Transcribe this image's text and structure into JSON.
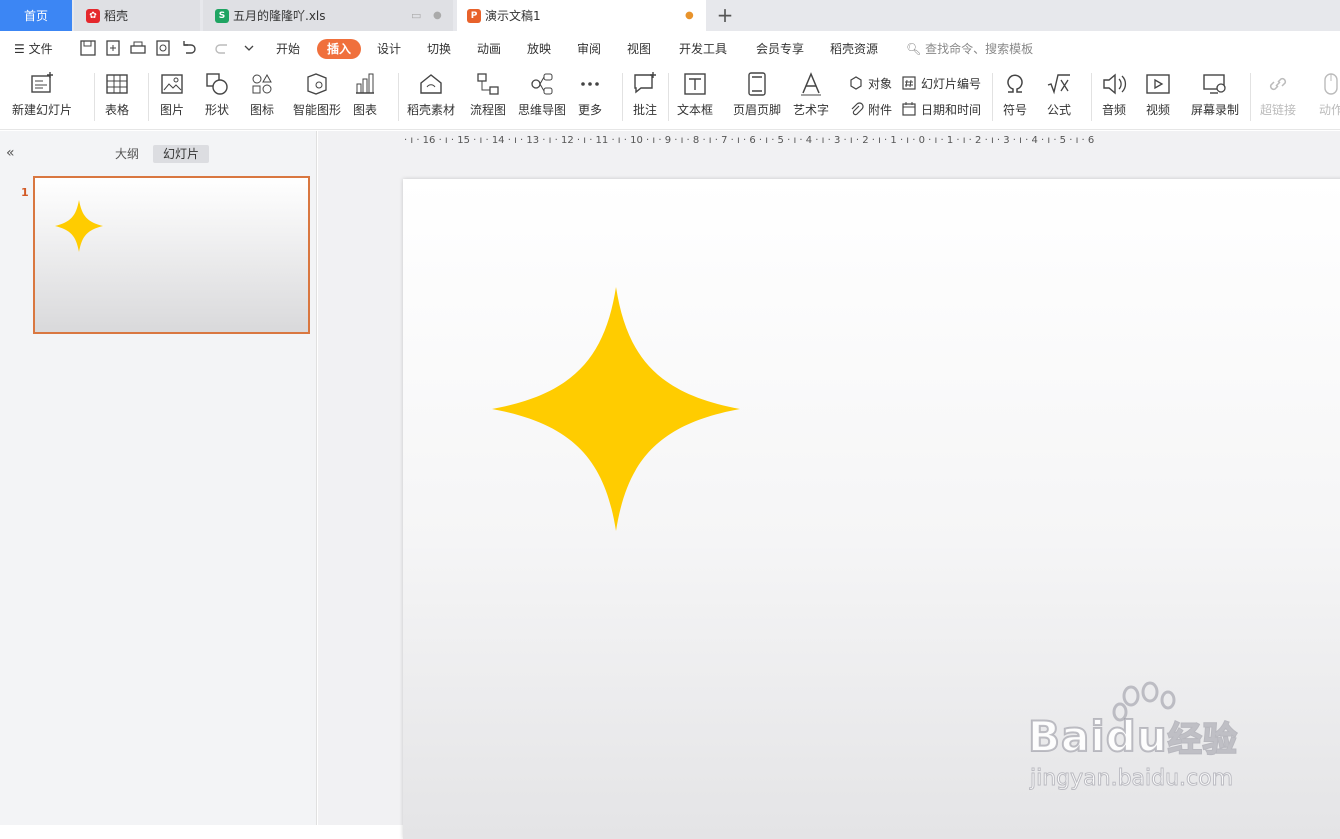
{
  "tabs": {
    "home": "首页",
    "daoke": "稻壳",
    "xls": "五月的隆隆吖.xls",
    "ppt": "演示文稿1",
    "add": "+"
  },
  "menu": {
    "file": "文件",
    "items": [
      "开始",
      "插入",
      "设计",
      "切换",
      "动画",
      "放映",
      "审阅",
      "视图",
      "开发工具",
      "会员专享",
      "稻壳资源"
    ],
    "active": "插入",
    "search_placeholder": "查找命令、搜索模板"
  },
  "toolbar": {
    "new_slide": "新建幻灯片",
    "table": "表格",
    "picture": "图片",
    "shape": "形状",
    "icon": "图标",
    "smart": "智能图形",
    "chart": "图表",
    "material": "稻壳素材",
    "flow": "流程图",
    "mind": "思维导图",
    "more": "更多",
    "comment": "批注",
    "textbox": "文本框",
    "header": "页眉页脚",
    "wordart": "艺术字",
    "object": "对象",
    "attach": "附件",
    "slide_number": "幻灯片编号",
    "datetime": "日期和时间",
    "symbol": "符号",
    "formula": "公式",
    "audio": "音频",
    "video": "视频",
    "record": "屏幕录制",
    "hyperlink": "超链接",
    "action": "动作"
  },
  "leftpane": {
    "outline": "大纲",
    "slides": "幻灯片",
    "slide_number": "1"
  },
  "ruler": "· ı · 16 · ı · 15 · ı · 14 · ı · 13 · ı · 12 · ı · 11 · ı · 10 · ı · 9 · ı · 8 · ı · 7 · ı · 6 · ı · 5 · ı · 4 · ı · 3 · ı · 2 · ı · 1 · ı · 0 · ı · 1 · ı · 2 · ı · 3 · ı · 4 · ı · 5 · ı · 6",
  "watermark": {
    "brand": "Bai",
    "brand2": "du",
    "cn": "经验",
    "url": "jingyan.baidu.com"
  },
  "colors": {
    "accent": "#f0703c",
    "star": "#ffcc00",
    "home_tab": "#3c86f4"
  }
}
